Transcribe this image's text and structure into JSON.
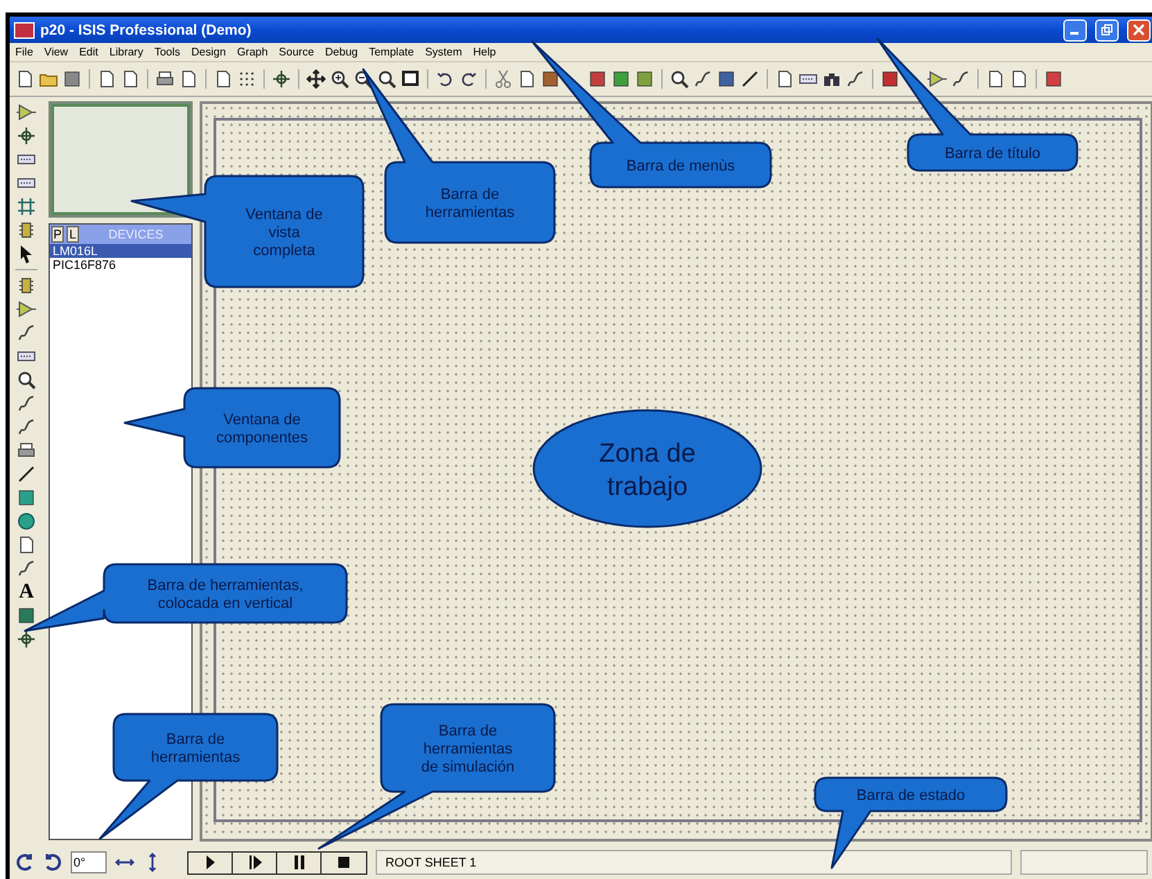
{
  "window": {
    "title": "p20 - ISIS Professional (Demo)"
  },
  "menu": [
    "File",
    "View",
    "Edit",
    "Library",
    "Tools",
    "Design",
    "Graph",
    "Source",
    "Debug",
    "Template",
    "System",
    "Help"
  ],
  "left_toolbar": {
    "text_tool": "A"
  },
  "device_selector": {
    "tabs": [
      "P",
      "L"
    ],
    "title": "DEVICES",
    "items": [
      {
        "label": "LM016L",
        "selected": true
      },
      {
        "label": "PIC16F876",
        "selected": false
      }
    ]
  },
  "orientation": {
    "value": "0°"
  },
  "simulation_controls": [
    {
      "kind": "play"
    },
    {
      "kind": "step"
    },
    {
      "kind": "pause"
    },
    {
      "kind": "stop"
    }
  ],
  "status_bar": {
    "text": "ROOT SHEET 1"
  },
  "callouts": [
    {
      "kind": "bubble",
      "lines": [
        "Barra de título"
      ]
    },
    {
      "kind": "bubble",
      "lines": [
        "Barra de menùs"
      ]
    },
    {
      "kind": "bubble",
      "lines": [
        "Barra de",
        "herramientas"
      ]
    },
    {
      "kind": "bubble",
      "lines": [
        "Ventana de",
        "vista",
        "completa"
      ]
    },
    {
      "kind": "bubble",
      "lines": [
        "Ventana de",
        "componentes"
      ]
    },
    {
      "kind": "bubble",
      "lines": [
        "Barra de herramientas,",
        "colocada en vertical"
      ]
    },
    {
      "kind": "ellipse",
      "lines": [
        "Zona de",
        "trabajo"
      ]
    },
    {
      "kind": "bubble",
      "lines": [
        "Barra de",
        "herramientas"
      ]
    },
    {
      "kind": "bubble",
      "lines": [
        "Barra de",
        "herramientas",
        "de simulación"
      ]
    },
    {
      "kind": "bubble",
      "lines": [
        "Barra de estado"
      ]
    }
  ]
}
